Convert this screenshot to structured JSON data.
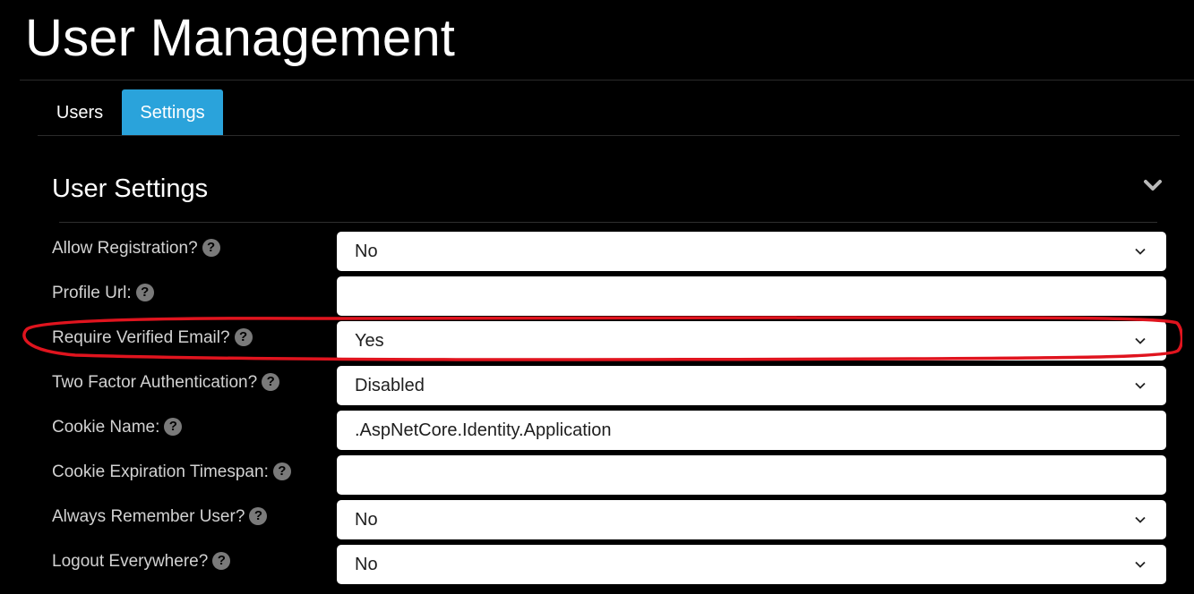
{
  "page": {
    "title": "User Management"
  },
  "tabs": [
    {
      "label": "Users",
      "active": false
    },
    {
      "label": "Settings",
      "active": true
    }
  ],
  "section": {
    "title": "User Settings",
    "collapse_icon": "chevron-down-icon"
  },
  "colors": {
    "active_tab": "#2aa3db",
    "highlight": "#e0141e",
    "background": "#000000"
  },
  "fields": {
    "allow_registration": {
      "label": "Allow Registration?",
      "value": "No"
    },
    "profile_url": {
      "label": "Profile Url:",
      "value": ""
    },
    "require_verified_email": {
      "label": "Require Verified Email?",
      "value": "Yes"
    },
    "two_factor": {
      "label": "Two Factor Authentication?",
      "value": "Disabled"
    },
    "cookie_name": {
      "label": "Cookie Name:",
      "value": ".AspNetCore.Identity.Application"
    },
    "cookie_expiration": {
      "label": "Cookie Expiration Timespan:",
      "value": ""
    },
    "always_remember": {
      "label": "Always Remember User?",
      "value": "No"
    },
    "logout_everywhere": {
      "label": "Logout Everywhere?",
      "value": "No"
    }
  },
  "help_glyph": "?"
}
